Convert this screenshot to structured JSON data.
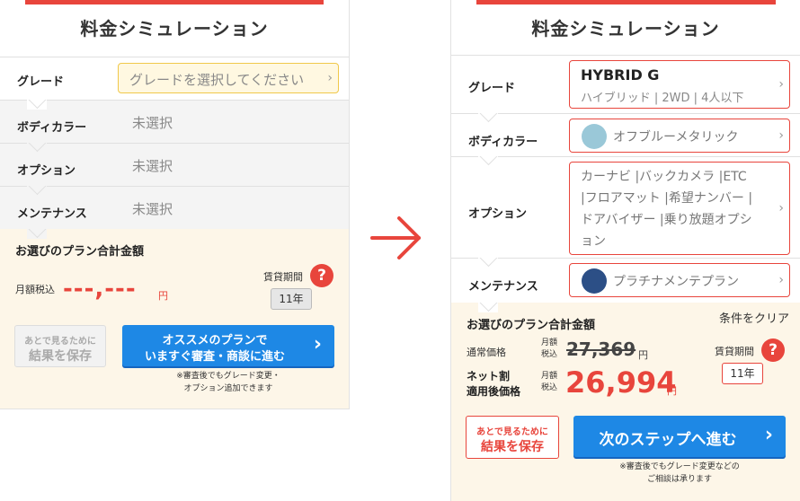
{
  "left": {
    "title": "料金シミュレーション",
    "rows": [
      {
        "label": "グレード",
        "value": "グレードを選択してください"
      },
      {
        "label": "ボディカラー",
        "value": "未選択"
      },
      {
        "label": "オプション",
        "value": "未選択"
      },
      {
        "label": "メンテナンス",
        "value": "未選択"
      }
    ],
    "summary": {
      "title": "お選びのプラン合計金額",
      "monthly_label": "月額税込",
      "price": "---,---",
      "yen": "円",
      "term_label": "賃貸期間",
      "term_value": "11年",
      "save_line1": "あとで見るために",
      "save_line2": "結果を保存",
      "cta_line1": "オススメのプランで",
      "cta_line2": "いますぐ審査・商談に進む",
      "note_line1": "※審査後でもグレード変更・",
      "note_line2": "オプション追加できます"
    }
  },
  "arrow": "→",
  "right": {
    "title": "料金シミュレーション",
    "grade": {
      "label": "グレード",
      "name": "HYBRID G",
      "detail": "ハイブリッド | 2WD | 4人以下"
    },
    "color": {
      "label": "ボディカラー",
      "value": "オフブルーメタリック",
      "swatch": "#9ac8d8"
    },
    "option": {
      "label": "オプション",
      "line1": "カーナビ |バックカメラ |ETC",
      "line2": "|フロアマット |希望ナンバー |",
      "line3": "ドアバイザー |乗り放題オプシ",
      "line4": "ョン"
    },
    "maintenance": {
      "label": "メンテナンス",
      "value": "プラチナメンテプラン",
      "swatch": "#2c4f86"
    },
    "summary": {
      "title": "お選びのプラン合計金額",
      "clear": "条件をクリア",
      "normal_label": "通常価格",
      "monthly_l1": "月額",
      "monthly_l2": "税込",
      "normal_price": "27,369",
      "yen": "円",
      "net_l1": "ネット割",
      "net_l2": "適用後価格",
      "net_price": "26,994",
      "term_label": "賃貸期間",
      "term_value": "11年",
      "save_line1": "あとで見るために",
      "save_line2": "結果を保存",
      "cta": "次のステップへ進む",
      "note_line1": "※審査後でもグレード変更などの",
      "note_line2": "ご相談は承ります"
    }
  },
  "colors": {
    "accent": "#e8453c",
    "blue": "#1e88e5",
    "cream": "#fdf6e8"
  }
}
